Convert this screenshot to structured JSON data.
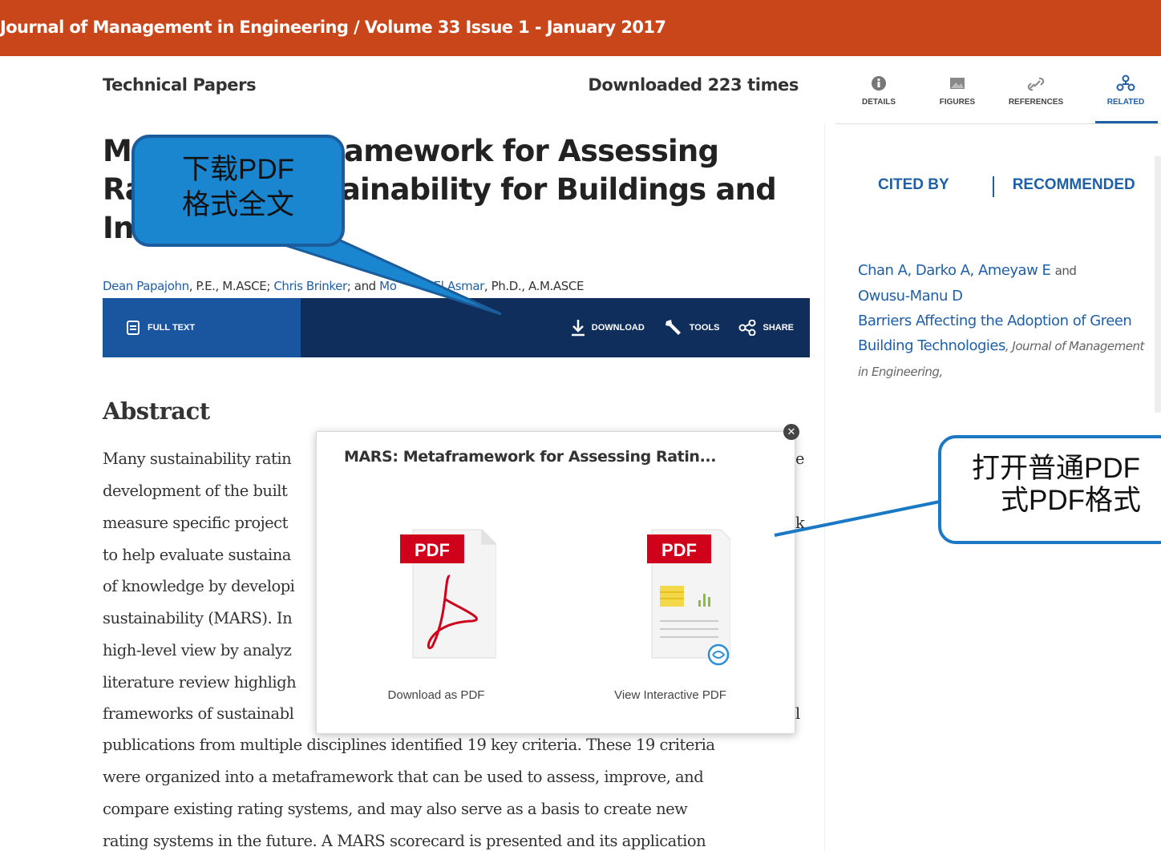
{
  "header": {
    "journal_title": "Journal of Management in Engineering / Volume 33 Issue 1 - January 2017"
  },
  "article": {
    "section": "Technical Papers",
    "downloads": "Downloaded 223 times",
    "title_lines": [
      "M",
      "amework for Assessing",
      "Ra",
      "ainability for Buildings and",
      "In"
    ],
    "authors": {
      "a1": "Dean Papajohn",
      "a1_cred": ", P.E., M.ASCE; ",
      "a2": "Chris Brinker",
      "a2_sep": "; and ",
      "a3": "Mo",
      "a3b": "r El Asmar",
      "a3_cred": ", Ph.D., A.M.ASCE"
    }
  },
  "actions": {
    "full_text": "FULL TEXT",
    "download": "DOWNLOAD",
    "tools": "TOOLS",
    "share": "SHARE"
  },
  "abstract": {
    "heading": "Abstract",
    "lines": [
      "Many sustainability ratin",
      "development of the built",
      "measure specific project",
      "to help evaluate sustaina",
      "of knowledge by developi",
      "sustainability (MARS). In",
      "high-level view by analyz",
      "literature review highligh",
      "frameworks of sustainabl",
      "publications from multiple disciplines identified 19 key criteria. These 19 criteria",
      "were organized into a metaframework that can be used to assess, improve, and",
      "compare existing rating systems, and may also serve as a basis to create new",
      "rating systems in the future. A MARS scorecard is presented and its application"
    ],
    "edge_fragments": [
      "e",
      "k",
      "l"
    ]
  },
  "right_tabs": [
    {
      "label": "DETAILS",
      "icon": "info-icon"
    },
    {
      "label": "FIGURES",
      "icon": "image-icon"
    },
    {
      "label": "REFERENCES",
      "icon": "link-icon"
    },
    {
      "label": "RELATED",
      "icon": "related-icon",
      "active": true
    }
  ],
  "related": {
    "cited_by": "CITED BY",
    "recommended": "RECOMMENDED",
    "citation": {
      "authors": "Chan A, Darko A, Ameyaw E",
      "and": "and",
      "authors2": "Owusu-Manu D",
      "title": "Barriers Affecting the Adoption of Green Building Technologies",
      "journal": ", Journal of Management in Engineering,"
    }
  },
  "modal": {
    "title": "MARS: Metaframework for Assessing Ratin...",
    "pdf_badge": "PDF",
    "option1": "Download as PDF",
    "option2": "View Interactive PDF"
  },
  "callouts": {
    "c1": [
      "下载PDF",
      "格式全文"
    ],
    "c2": [
      "打开普通PDF",
      "式PDF格式"
    ]
  },
  "colors": {
    "header": "#c9461a",
    "action_bar": "#0f2e5c",
    "full_text_bg": "#1a56a0",
    "link": "#1f5fa8",
    "pdf_red": "#d0021b",
    "callout_blue": "#1a86cf"
  }
}
